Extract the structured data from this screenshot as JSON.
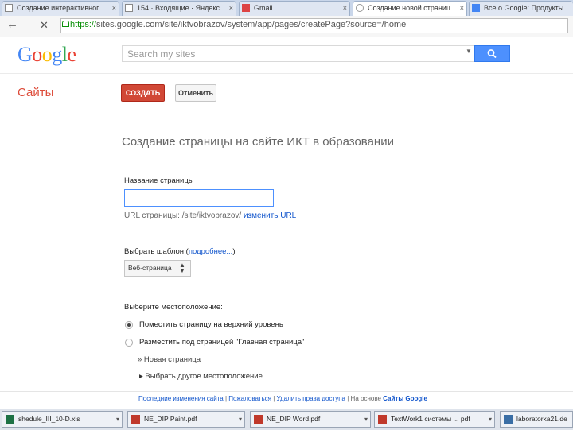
{
  "browser": {
    "tabs": [
      {
        "label": "Создание интерактивног",
        "active": false
      },
      {
        "label": "154 · Входящие · Яндекс",
        "active": false
      },
      {
        "label": "Gmail",
        "active": false
      },
      {
        "label": "Создание новой страниц",
        "active": true
      },
      {
        "label": "Все о Google: Продукты",
        "active": false
      }
    ],
    "tab_close": "×",
    "back": "←",
    "reload": "✕",
    "url_scheme": "https://",
    "url_rest": "sites.google.com/site/iktvobrazov/system/app/pages/createPage?source=/home"
  },
  "header": {
    "logo_letters": [
      {
        "ch": "G",
        "color": "#4285f4"
      },
      {
        "ch": "o",
        "color": "#ea4335"
      },
      {
        "ch": "o",
        "color": "#fbbc05"
      },
      {
        "ch": "g",
        "color": "#4285f4"
      },
      {
        "ch": "l",
        "color": "#34a853"
      },
      {
        "ch": "e",
        "color": "#ea4335"
      }
    ],
    "search_placeholder": "Search my sites",
    "search_caret": "▼"
  },
  "sites": {
    "title": "Сайты",
    "create_label": "СОЗДАТЬ",
    "cancel_label": "Отменить"
  },
  "form": {
    "heading": "Создание страницы на сайте ИКТ в образовании",
    "name_label": "Название страницы",
    "url_prefix": "URL страницы: /site/iktvobrazov/",
    "url_change": "изменить URL",
    "template_label": "Выбрать шаблон (",
    "template_more": "подробнее...",
    "template_close": ")",
    "template_value": "Веб-страница",
    "template_arrow": "▲▼",
    "location_label": "Выберите местоположение:",
    "option_top": "Поместить страницу на верхний уровень",
    "option_under": "Разместить под страницей \"Главная страница\"",
    "sub_new_page": "» Новая страница",
    "sub_choose_other": "▸ Выбрать другое местоположение"
  },
  "footer": {
    "links": [
      "Последние изменения сайта",
      "Пожаловаться",
      "Удалить права доступа"
    ],
    "powered": "На основе",
    "powered_link": "Сайты Google"
  },
  "taskbar": [
    {
      "label": "shedule_III_10-D.xls",
      "icon": "xls"
    },
    {
      "label": "NE_DIP Paint.pdf",
      "icon": "pdf"
    },
    {
      "label": "NE_DIP Word.pdf",
      "icon": "pdf"
    },
    {
      "label": "TextWork1 системы ... pdf",
      "icon": "pdf"
    },
    {
      "label": "laboratorka21.de",
      "icon": "img"
    }
  ],
  "taskbar_more": "▾"
}
